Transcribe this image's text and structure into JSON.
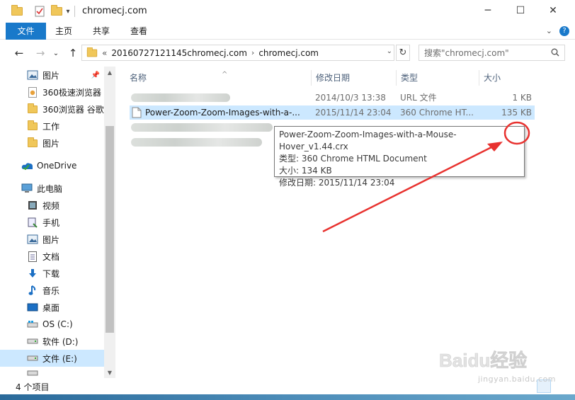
{
  "window": {
    "title": "chromecj.com",
    "controls": {
      "minimize": "─",
      "maximize": "☐",
      "close": "✕"
    }
  },
  "ribbon": {
    "tabs": [
      "文件",
      "主页",
      "共享",
      "查看"
    ],
    "expand_glyph": "⌄",
    "help_glyph": "?"
  },
  "address": {
    "back": "←",
    "forward": "→",
    "recent": "⌄",
    "up": "↑",
    "overflow": "«",
    "crumbs": [
      "20160727121145chromecj.com",
      "chromecj.com"
    ],
    "crumb_sep": "›",
    "dropdown": "⌄",
    "refresh": "↻",
    "search_placeholder": "搜索\"chromecj.com\""
  },
  "nav": {
    "items": [
      {
        "label": "图片",
        "icon": "pictures-icon",
        "pinned": true,
        "pin_glyph": "📌"
      },
      {
        "label": "360极速浏览器",
        "icon": "app-file-icon"
      },
      {
        "label": "360浏览器 谷歌",
        "icon": "folder-icon"
      },
      {
        "label": "工作",
        "icon": "folder-icon"
      },
      {
        "label": "图片",
        "icon": "folder-icon"
      },
      {
        "label": "OneDrive",
        "icon": "onedrive-icon"
      },
      {
        "label": "此电脑",
        "icon": "computer-icon"
      },
      {
        "label": "视频",
        "icon": "videos-icon"
      },
      {
        "label": "手机",
        "icon": "phone-icon"
      },
      {
        "label": "图片",
        "icon": "pictures-icon"
      },
      {
        "label": "文档",
        "icon": "documents-icon"
      },
      {
        "label": "下载",
        "icon": "downloads-icon"
      },
      {
        "label": "音乐",
        "icon": "music-icon"
      },
      {
        "label": "桌面",
        "icon": "desktop-icon"
      },
      {
        "label": "OS (C:)",
        "icon": "os-drive-icon"
      },
      {
        "label": "软件 (D:)",
        "icon": "drive-icon"
      },
      {
        "label": "文件 (E:)",
        "icon": "drive-icon",
        "selected": true
      }
    ],
    "scroll_up": "▲",
    "scroll_down": "▼"
  },
  "columns": {
    "name": "名称",
    "date": "修改日期",
    "type": "类型",
    "size": "大小",
    "sort_glyph": "^"
  },
  "files": [
    {
      "name": "",
      "date": "2014/10/3 13:38",
      "type": "URL 文件",
      "size": "1 KB",
      "icon": "url-file-icon",
      "obscured": true
    },
    {
      "name": "Power-Zoom-Zoom-Images-with-a-...",
      "date": "2015/11/14 23:04",
      "type": "360 Chrome HT...",
      "size": "135 KB",
      "icon": "document-icon",
      "selected": true
    }
  ],
  "tooltip": {
    "name": "Power-Zoom-Zoom-Images-with-a-Mouse-Hover_v1.44.crx",
    "type": "类型: 360 Chrome HTML Document",
    "size": "大小: 134 KB",
    "modified": "修改日期: 2015/11/14 23:04"
  },
  "status": {
    "count": "4 个项目"
  },
  "watermark": {
    "logo": "Baidu经验",
    "url": "jingyan.baidu.com"
  },
  "colors": {
    "accent": "#1979ca",
    "selection": "#cce8ff",
    "annotation": "#e8322f"
  }
}
